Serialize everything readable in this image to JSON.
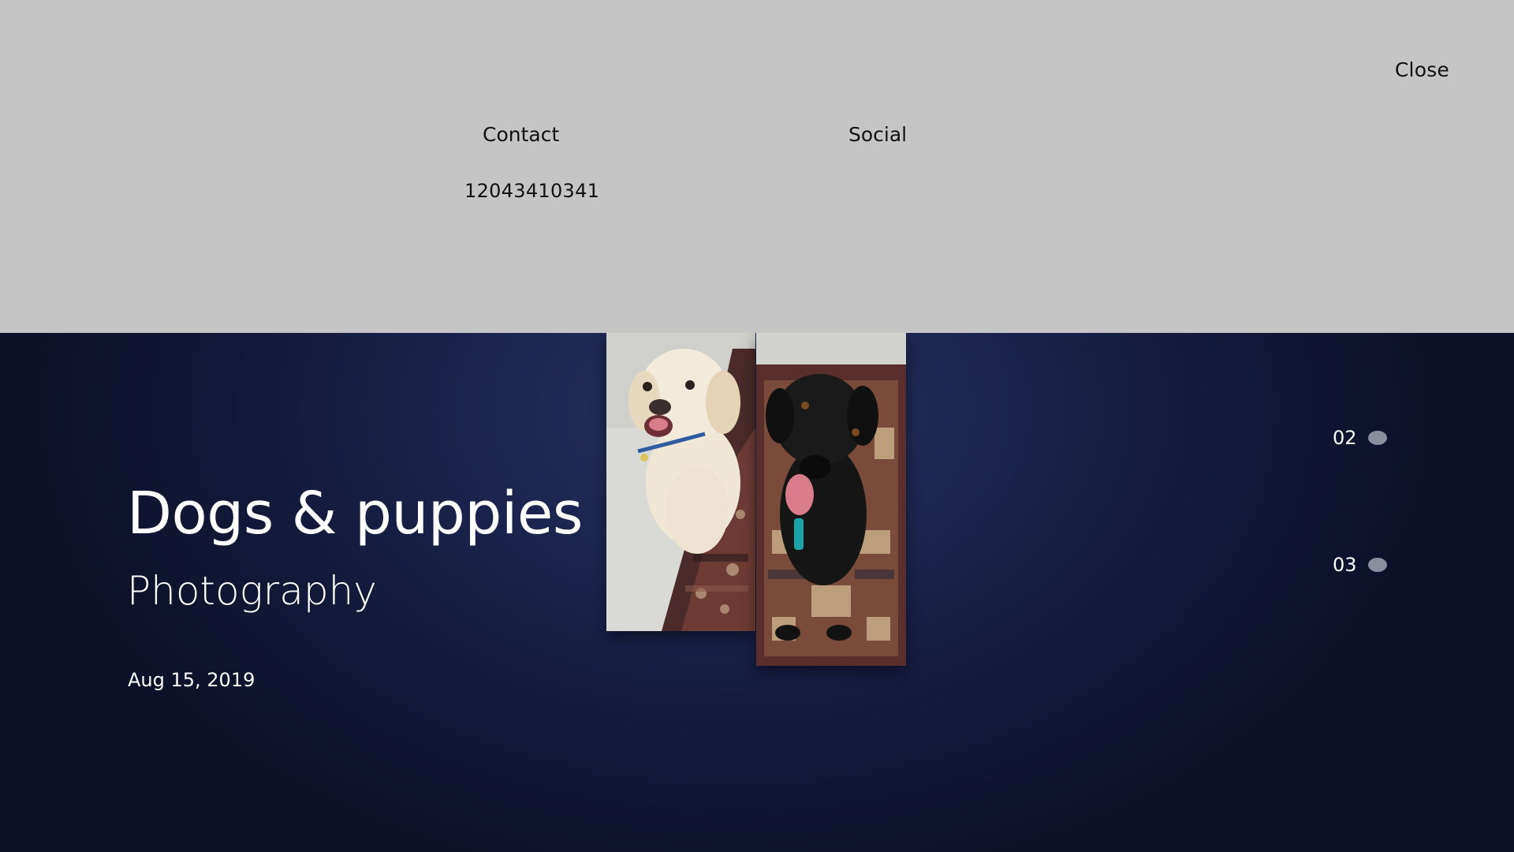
{
  "overlay": {
    "close_label": "Close",
    "contact_heading": "Contact",
    "social_heading": "Social",
    "phone": "12043410341",
    "bg_color": "#c5c5c5"
  },
  "hero": {
    "title": "Dogs & puppies",
    "subtitle": "Photography",
    "date": "Aug 15, 2019",
    "bg_color": "#1c2550"
  },
  "photos": [
    {
      "icon": "cream-doodle-dog-photo"
    },
    {
      "icon": "black-labrador-dog-photo"
    }
  ],
  "slide_nav": [
    {
      "label": "02",
      "icon": "dot-indicator"
    },
    {
      "label": "03",
      "icon": "dot-indicator"
    }
  ]
}
